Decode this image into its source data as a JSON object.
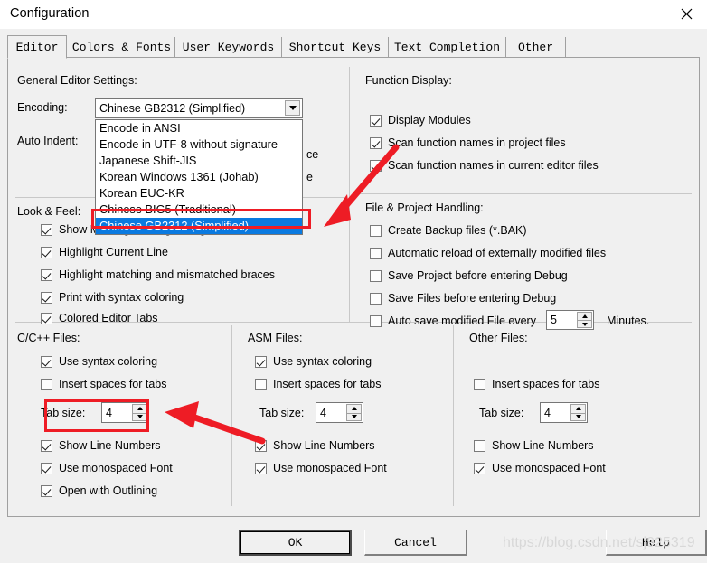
{
  "window": {
    "title": "Configuration",
    "close_icon": "close-icon"
  },
  "tabs": [
    {
      "label": "Editor",
      "active": true
    },
    {
      "label": "Colors & Fonts",
      "active": false
    },
    {
      "label": "User Keywords",
      "active": false
    },
    {
      "label": "Shortcut Keys",
      "active": false
    },
    {
      "label": "Text Completion",
      "active": false
    },
    {
      "label": "Other",
      "active": false
    }
  ],
  "general": {
    "group_label": "General Editor Settings:",
    "encoding_label": "Encoding:",
    "auto_indent_label": "Auto Indent:",
    "encoding_value": "Chinese GB2312 (Simplified)",
    "dropdown_items": [
      "Encode in ANSI",
      "Encode in UTF-8 without signature",
      "Japanese Shift-JIS",
      "Korean Windows 1361 (Johab)",
      "Korean EUC-KR",
      "Chinese BIG5 (Traditional)",
      "Chinese GB2312 (Simplified)"
    ],
    "dropdown_selected_index": 6,
    "occluded_radio_text_1": "ce",
    "occluded_radio_text_2": "e"
  },
  "look_feel": {
    "group_label": "Look & Feel:",
    "items": [
      {
        "label": "Show Message Dialog during Find",
        "checked": true
      },
      {
        "label": "Highlight Current Line",
        "checked": true
      },
      {
        "label": "Highlight matching and mismatched braces",
        "checked": true
      },
      {
        "label": "Print with syntax coloring",
        "checked": true
      },
      {
        "label": "Colored Editor Tabs",
        "checked": true
      }
    ]
  },
  "function_display": {
    "group_label": "Function Display:",
    "items": [
      {
        "label": "Display Modules",
        "checked": true
      },
      {
        "label": "Scan function names in project files",
        "checked": true
      },
      {
        "label": "Scan function names in current editor files",
        "checked": true
      }
    ]
  },
  "file_project": {
    "group_label": "File & Project Handling:",
    "items": [
      {
        "label": "Create Backup files (*.BAK)",
        "checked": false
      },
      {
        "label": "Automatic reload of externally modified files",
        "checked": false
      },
      {
        "label": "Save Project before entering Debug",
        "checked": false
      },
      {
        "label": "Save Files before entering Debug",
        "checked": false
      },
      {
        "label": "Auto save modified File every",
        "checked": false
      }
    ],
    "autosave_value": "5",
    "autosave_suffix": "Minutes."
  },
  "cpp_files": {
    "group_label": "C/C++ Files:",
    "items": [
      {
        "label": "Use syntax coloring",
        "checked": true
      },
      {
        "label": "Insert spaces for tabs",
        "checked": false
      }
    ],
    "tab_size_label": "Tab size:",
    "tab_size_value": "4",
    "items_after": [
      {
        "label": "Show Line Numbers",
        "checked": true
      },
      {
        "label": "Use monospaced Font",
        "checked": true
      },
      {
        "label": "Open with Outlining",
        "checked": true
      }
    ]
  },
  "asm_files": {
    "group_label": "ASM Files:",
    "items": [
      {
        "label": "Use syntax coloring",
        "checked": true
      },
      {
        "label": "Insert spaces for tabs",
        "checked": false
      }
    ],
    "tab_size_label": "Tab size:",
    "tab_size_value": "4",
    "items_after": [
      {
        "label": "Show Line Numbers",
        "checked": true
      },
      {
        "label": "Use monospaced Font",
        "checked": true
      }
    ]
  },
  "other_files": {
    "group_label": "Other Files:",
    "items": [
      {
        "label": "Insert spaces for tabs",
        "checked": false
      }
    ],
    "tab_size_label": "Tab size:",
    "tab_size_value": "4",
    "items_after": [
      {
        "label": "Show Line Numbers",
        "checked": false
      },
      {
        "label": "Use monospaced Font",
        "checked": true
      }
    ]
  },
  "buttons": {
    "ok": "OK",
    "cancel": "Cancel",
    "help": "Help"
  },
  "annotations": {
    "accent_color": "#ee1c25",
    "highlight_color": "#0a7ae0",
    "arrow_1_name": "red-arrow-to-encoding-selection",
    "arrow_2_name": "red-arrow-to-tab-size",
    "rect_1_name": "red-box-encoding-selected-item",
    "rect_2_name": "red-box-tab-size"
  },
  "watermark": {
    "text": "https://blog.csdn.net/sj925319"
  }
}
